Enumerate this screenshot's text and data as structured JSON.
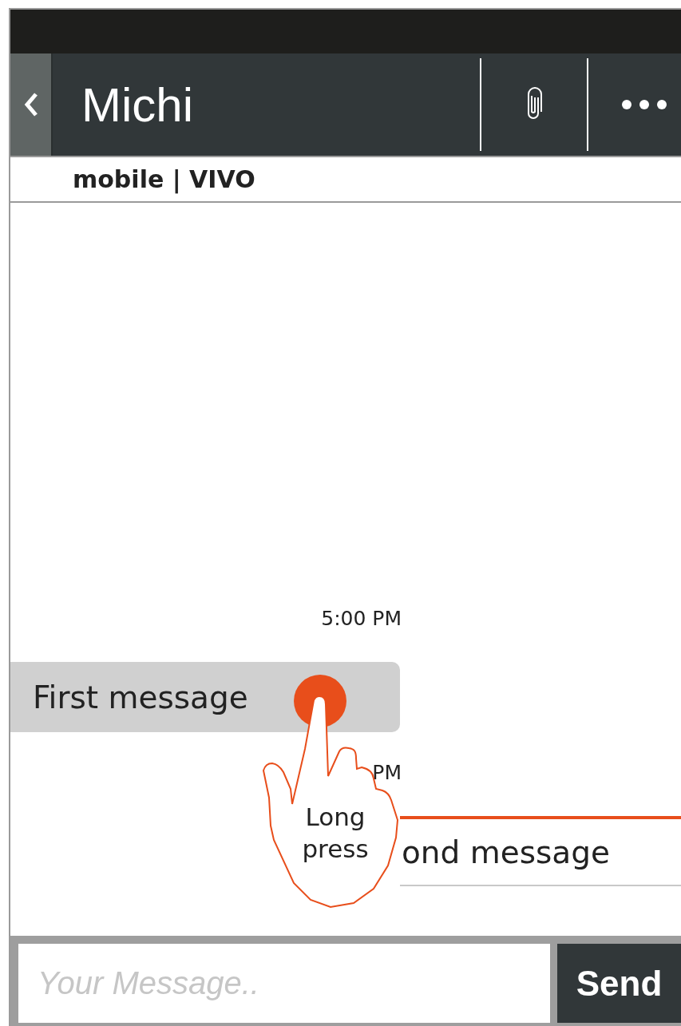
{
  "header": {
    "title": "Michi",
    "subtitle": "mobile | VIVO"
  },
  "messages": [
    {
      "kind": "time",
      "text": "5:00 PM"
    },
    {
      "kind": "incoming",
      "text": "First message"
    },
    {
      "kind": "time",
      "text": "PM"
    },
    {
      "kind": "outgoing",
      "text": "ond message"
    }
  ],
  "gesture": {
    "label": "Long press"
  },
  "composer": {
    "placeholder": "Your Message..",
    "button": "Send"
  }
}
